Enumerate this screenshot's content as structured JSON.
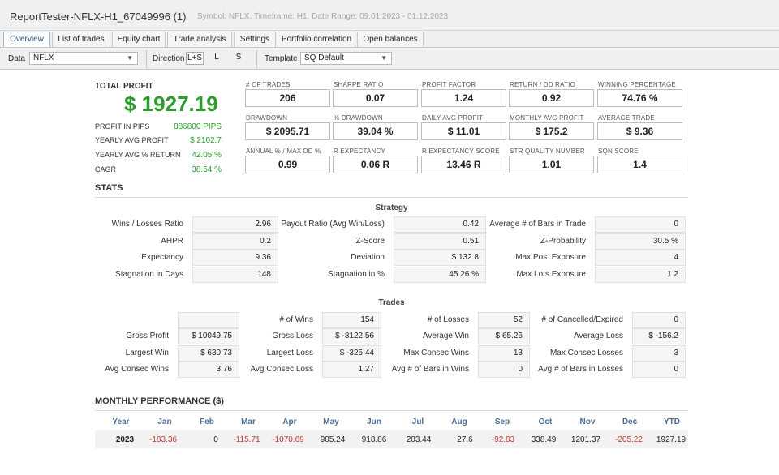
{
  "window": {
    "title": "ReportTester-NFLX-H1_67049996 (1)",
    "subtitle": "Symbol: NFLX, Timeframe: H1, Date Range: 09.01.2023 - 01.12.2023"
  },
  "tabs": [
    "Overview",
    "List of trades",
    "Equity chart",
    "Trade analysis",
    "Settings",
    "Portfolio correlation",
    "Open balances"
  ],
  "toolbar": {
    "data_label": "Data",
    "data_value": "NFLX",
    "direction_label": "Direction",
    "directions": [
      "L+S",
      "L",
      "S"
    ],
    "template_label": "Template",
    "template_value": "SQ Default",
    "arrow": "▼"
  },
  "summary": {
    "total_profit_label": "TOTAL PROFIT",
    "total_profit": "$ 1927.19",
    "rows": [
      {
        "label": "PROFIT IN PIPS",
        "value": "886800 PIPS"
      },
      {
        "label": "YEARLY AVG PROFIT",
        "value": "$ 2102.7"
      },
      {
        "label": "YEARLY AVG % RETURN",
        "value": "42.05 %"
      },
      {
        "label": "CAGR",
        "value": "38.54 %"
      }
    ]
  },
  "metrics": [
    {
      "label": "# OF TRADES",
      "value": "206"
    },
    {
      "label": "SHARPE RATIO",
      "value": "0.07"
    },
    {
      "label": "PROFIT FACTOR",
      "value": "1.24"
    },
    {
      "label": "RETURN / DD RATIO",
      "value": "0.92"
    },
    {
      "label": "WINNING PERCENTAGE",
      "value": "74.76 %"
    },
    {
      "label": "DRAWDOWN",
      "value": "$ 2095.71"
    },
    {
      "label": "% DRAWDOWN",
      "value": "39.04 %"
    },
    {
      "label": "DAILY AVG PROFIT",
      "value": "$ 11.01"
    },
    {
      "label": "MONTHLY AVG PROFIT",
      "value": "$ 175.2"
    },
    {
      "label": "AVERAGE TRADE",
      "value": "$ 9.36"
    },
    {
      "label": "ANNUAL % / MAX DD %",
      "value": "0.99"
    },
    {
      "label": "R EXPECTANCY",
      "value": "0.06 R"
    },
    {
      "label": "R EXPECTANCY SCORE",
      "value": "13.46 R"
    },
    {
      "label": "STR QUALITY NUMBER",
      "value": "1.01"
    },
    {
      "label": "SQN SCORE",
      "value": "1.4"
    }
  ],
  "stats": {
    "title": "STATS",
    "strategy_title": "Strategy",
    "strategy": [
      [
        {
          "label": "Wins / Losses Ratio",
          "value": "2.96"
        },
        {
          "label": "Payout Ratio (Avg Win/Loss)",
          "value": "0.42"
        },
        {
          "label": "Average # of Bars in Trade",
          "value": "0"
        }
      ],
      [
        {
          "label": "AHPR",
          "value": "0.2"
        },
        {
          "label": "Z-Score",
          "value": "0.51"
        },
        {
          "label": "Z-Probability",
          "value": "30.5 %"
        }
      ],
      [
        {
          "label": "Expectancy",
          "value": "9.36"
        },
        {
          "label": "Deviation",
          "value": "$ 132.8"
        },
        {
          "label": "Max Pos. Exposure",
          "value": "4"
        }
      ],
      [
        {
          "label": "Stagnation in Days",
          "value": "148"
        },
        {
          "label": "Stagnation in %",
          "value": "45.26 %"
        },
        {
          "label": "Max Lots Exposure",
          "value": "1.2"
        }
      ]
    ],
    "trades_title": "Trades",
    "trades": [
      [
        {
          "label": "",
          "value": ""
        },
        {
          "label": "# of Wins",
          "value": "154"
        },
        {
          "label": "# of Losses",
          "value": "52"
        },
        {
          "label": "# of Cancelled/Expired",
          "value": "0"
        }
      ],
      [
        {
          "label": "Gross Profit",
          "value": "$ 10049.75"
        },
        {
          "label": "Gross Loss",
          "value": "$ -8122.56"
        },
        {
          "label": "Average Win",
          "value": "$ 65.26"
        },
        {
          "label": "Average Loss",
          "value": "$ -156.2"
        }
      ],
      [
        {
          "label": "Largest Win",
          "value": "$ 630.73"
        },
        {
          "label": "Largest Loss",
          "value": "$ -325.44"
        },
        {
          "label": "Max Consec Wins",
          "value": "13"
        },
        {
          "label": "Max Consec Losses",
          "value": "3"
        }
      ],
      [
        {
          "label": "Avg Consec Wins",
          "value": "3.76"
        },
        {
          "label": "Avg Consec Loss",
          "value": "1.27"
        },
        {
          "label": "Avg # of Bars in Wins",
          "value": "0"
        },
        {
          "label": "Avg # of Bars in Losses",
          "value": "0"
        }
      ]
    ]
  },
  "monthly": {
    "title": "MONTHLY PERFORMANCE ($)",
    "headers": [
      "Year",
      "Jan",
      "Feb",
      "Mar",
      "Apr",
      "May",
      "Jun",
      "Jul",
      "Aug",
      "Sep",
      "Oct",
      "Nov",
      "Dec",
      "YTD"
    ],
    "rows": [
      [
        "2023",
        "-183.36",
        "0",
        "-115.71",
        "-1070.69",
        "905.24",
        "918.86",
        "203.44",
        "27.6",
        "-92.83",
        "338.49",
        "1201.37",
        "-205.22",
        "1927.19"
      ]
    ],
    "colors": {
      "negative": "#c0392b",
      "header": "#4a6d94",
      "profit": "#2a9d2a"
    }
  }
}
